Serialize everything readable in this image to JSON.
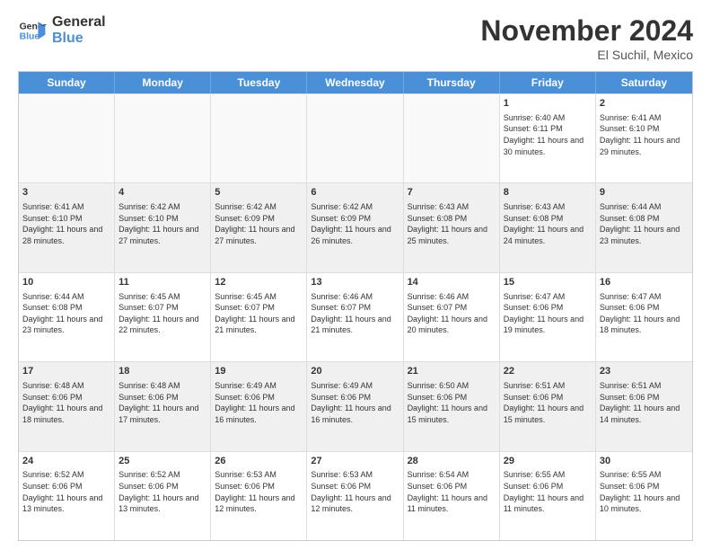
{
  "logo": {
    "line1": "General",
    "line2": "Blue"
  },
  "title": "November 2024",
  "location": "El Suchil, Mexico",
  "days_of_week": [
    "Sunday",
    "Monday",
    "Tuesday",
    "Wednesday",
    "Thursday",
    "Friday",
    "Saturday"
  ],
  "weeks": [
    {
      "cells": [
        {
          "day": "",
          "empty": true
        },
        {
          "day": "",
          "empty": true
        },
        {
          "day": "",
          "empty": true
        },
        {
          "day": "",
          "empty": true
        },
        {
          "day": "",
          "empty": true
        },
        {
          "day": "1",
          "sunrise": "Sunrise: 6:40 AM",
          "sunset": "Sunset: 6:11 PM",
          "daylight": "Daylight: 11 hours and 30 minutes."
        },
        {
          "day": "2",
          "sunrise": "Sunrise: 6:41 AM",
          "sunset": "Sunset: 6:10 PM",
          "daylight": "Daylight: 11 hours and 29 minutes."
        }
      ]
    },
    {
      "cells": [
        {
          "day": "3",
          "sunrise": "Sunrise: 6:41 AM",
          "sunset": "Sunset: 6:10 PM",
          "daylight": "Daylight: 11 hours and 28 minutes."
        },
        {
          "day": "4",
          "sunrise": "Sunrise: 6:42 AM",
          "sunset": "Sunset: 6:10 PM",
          "daylight": "Daylight: 11 hours and 27 minutes."
        },
        {
          "day": "5",
          "sunrise": "Sunrise: 6:42 AM",
          "sunset": "Sunset: 6:09 PM",
          "daylight": "Daylight: 11 hours and 27 minutes."
        },
        {
          "day": "6",
          "sunrise": "Sunrise: 6:42 AM",
          "sunset": "Sunset: 6:09 PM",
          "daylight": "Daylight: 11 hours and 26 minutes."
        },
        {
          "day": "7",
          "sunrise": "Sunrise: 6:43 AM",
          "sunset": "Sunset: 6:08 PM",
          "daylight": "Daylight: 11 hours and 25 minutes."
        },
        {
          "day": "8",
          "sunrise": "Sunrise: 6:43 AM",
          "sunset": "Sunset: 6:08 PM",
          "daylight": "Daylight: 11 hours and 24 minutes."
        },
        {
          "day": "9",
          "sunrise": "Sunrise: 6:44 AM",
          "sunset": "Sunset: 6:08 PM",
          "daylight": "Daylight: 11 hours and 23 minutes."
        }
      ]
    },
    {
      "cells": [
        {
          "day": "10",
          "sunrise": "Sunrise: 6:44 AM",
          "sunset": "Sunset: 6:08 PM",
          "daylight": "Daylight: 11 hours and 23 minutes."
        },
        {
          "day": "11",
          "sunrise": "Sunrise: 6:45 AM",
          "sunset": "Sunset: 6:07 PM",
          "daylight": "Daylight: 11 hours and 22 minutes."
        },
        {
          "day": "12",
          "sunrise": "Sunrise: 6:45 AM",
          "sunset": "Sunset: 6:07 PM",
          "daylight": "Daylight: 11 hours and 21 minutes."
        },
        {
          "day": "13",
          "sunrise": "Sunrise: 6:46 AM",
          "sunset": "Sunset: 6:07 PM",
          "daylight": "Daylight: 11 hours and 21 minutes."
        },
        {
          "day": "14",
          "sunrise": "Sunrise: 6:46 AM",
          "sunset": "Sunset: 6:07 PM",
          "daylight": "Daylight: 11 hours and 20 minutes."
        },
        {
          "day": "15",
          "sunrise": "Sunrise: 6:47 AM",
          "sunset": "Sunset: 6:06 PM",
          "daylight": "Daylight: 11 hours and 19 minutes."
        },
        {
          "day": "16",
          "sunrise": "Sunrise: 6:47 AM",
          "sunset": "Sunset: 6:06 PM",
          "daylight": "Daylight: 11 hours and 18 minutes."
        }
      ]
    },
    {
      "cells": [
        {
          "day": "17",
          "sunrise": "Sunrise: 6:48 AM",
          "sunset": "Sunset: 6:06 PM",
          "daylight": "Daylight: 11 hours and 18 minutes."
        },
        {
          "day": "18",
          "sunrise": "Sunrise: 6:48 AM",
          "sunset": "Sunset: 6:06 PM",
          "daylight": "Daylight: 11 hours and 17 minutes."
        },
        {
          "day": "19",
          "sunrise": "Sunrise: 6:49 AM",
          "sunset": "Sunset: 6:06 PM",
          "daylight": "Daylight: 11 hours and 16 minutes."
        },
        {
          "day": "20",
          "sunrise": "Sunrise: 6:49 AM",
          "sunset": "Sunset: 6:06 PM",
          "daylight": "Daylight: 11 hours and 16 minutes."
        },
        {
          "day": "21",
          "sunrise": "Sunrise: 6:50 AM",
          "sunset": "Sunset: 6:06 PM",
          "daylight": "Daylight: 11 hours and 15 minutes."
        },
        {
          "day": "22",
          "sunrise": "Sunrise: 6:51 AM",
          "sunset": "Sunset: 6:06 PM",
          "daylight": "Daylight: 11 hours and 15 minutes."
        },
        {
          "day": "23",
          "sunrise": "Sunrise: 6:51 AM",
          "sunset": "Sunset: 6:06 PM",
          "daylight": "Daylight: 11 hours and 14 minutes."
        }
      ]
    },
    {
      "cells": [
        {
          "day": "24",
          "sunrise": "Sunrise: 6:52 AM",
          "sunset": "Sunset: 6:06 PM",
          "daylight": "Daylight: 11 hours and 13 minutes."
        },
        {
          "day": "25",
          "sunrise": "Sunrise: 6:52 AM",
          "sunset": "Sunset: 6:06 PM",
          "daylight": "Daylight: 11 hours and 13 minutes."
        },
        {
          "day": "26",
          "sunrise": "Sunrise: 6:53 AM",
          "sunset": "Sunset: 6:06 PM",
          "daylight": "Daylight: 11 hours and 12 minutes."
        },
        {
          "day": "27",
          "sunrise": "Sunrise: 6:53 AM",
          "sunset": "Sunset: 6:06 PM",
          "daylight": "Daylight: 11 hours and 12 minutes."
        },
        {
          "day": "28",
          "sunrise": "Sunrise: 6:54 AM",
          "sunset": "Sunset: 6:06 PM",
          "daylight": "Daylight: 11 hours and 11 minutes."
        },
        {
          "day": "29",
          "sunrise": "Sunrise: 6:55 AM",
          "sunset": "Sunset: 6:06 PM",
          "daylight": "Daylight: 11 hours and 11 minutes."
        },
        {
          "day": "30",
          "sunrise": "Sunrise: 6:55 AM",
          "sunset": "Sunset: 6:06 PM",
          "daylight": "Daylight: 11 hours and 10 minutes."
        }
      ]
    }
  ]
}
